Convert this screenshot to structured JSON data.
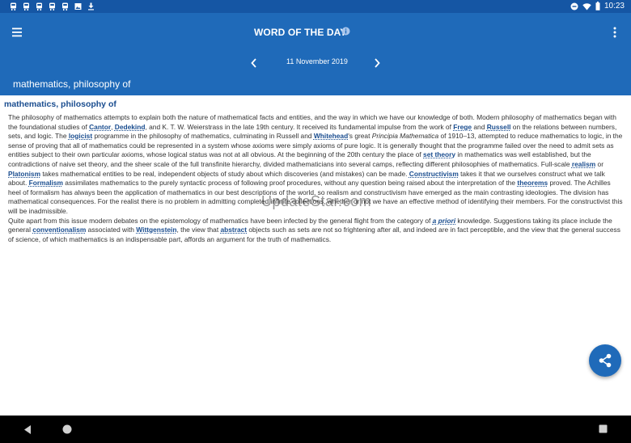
{
  "status_bar": {
    "time": "10:23",
    "notification_icons": [
      "train-icon",
      "train-icon",
      "train-icon",
      "train-icon",
      "train-icon",
      "image-icon",
      "download-icon"
    ],
    "system_icons": [
      "minus-circle-icon",
      "wifi-icon",
      "battery-icon"
    ]
  },
  "app_bar": {
    "title": "WORD OF THE DAY",
    "date": "11 November 2019",
    "current_word": "mathematics, philosophy of"
  },
  "entry": {
    "title": "mathematics, philosophy of",
    "s1": "The philosophy of mathematics attempts to explain both the nature of mathematical facts and entities, and the way in which we have our knowledge of both. Modern philosophy of mathematics began with the foundational studies of ",
    "l_cantor": "Cantor",
    "s2": ", ",
    "l_dedekind": "Dedekind",
    "s3": ", and K. T. W. Weierstrass in the late 19th century. It received its fundamental impulse from the work of ",
    "l_frege": "Frege",
    "s4": " and ",
    "l_russell": "Russell",
    "s5": " on the relations between numbers, sets, and logic. The ",
    "l_logicist": "logicist",
    "s6": " programme in the philosophy of mathematics, culminating in Russell and ",
    "l_whitehead": "Whitehead",
    "s7": "'s great ",
    "i_principia": "Principia Mathematica",
    "s8": " of 1910–13, attempted to reduce mathematics to logic, in the sense of proving that all of mathematics could be represented in a system whose axioms were simply axioms of pure logic. It is generally thought that the programme failed over the need to admit sets as entities subject to their own particular axioms, whose logical status was not at all obvious. At the beginning of the 20th century the place of ",
    "l_settheory": "set theory",
    "s9": " in mathematics was well established, but the contradictions of naive set theory, and the sheer scale of the full transfinite hierarchy, divided mathematicians into several camps, reflecting different philosophies of mathematics. Full-scale ",
    "l_realism": "realism",
    "s10": " or ",
    "l_platonism": "Platonism",
    "s11": " takes mathematical entities to be real, independent objects of study about which discoveries (and mistakes) can be made. ",
    "l_constructivism": "Constructivism",
    "s12": " takes it that we ourselves construct what we talk about. ",
    "l_formalism": "Formalism",
    "s13": " assimilates mathematics to the purely syntactic process of following proof procedures, without any question being raised about the interpretation of the ",
    "l_theorems": "theorems",
    "s14": " proved. The Achilles heel of formalism has always been the application of mathematics in our best descriptions of the world, so realism and constructivism have emerged as the main contrasting ideologies. The division has mathematical consequences. For the realist there is no problem in admitting completed infinite collections, whether or not we have an effective method of identifying their members. For the constructivist this will be inadmissible.",
    "p2_s1": "Quite apart from this issue modern debates on the epistemology of mathematics have been infected by the general flight from the category of ",
    "l_apriori": "a priori",
    "p2_s2": " knowledge. Suggestions taking its place include the general ",
    "l_conventionalism": "conventionalism",
    "p2_s3": " associated with ",
    "l_wittgenstein": "Wittgenstein",
    "p2_s4": ", the view that ",
    "l_abstract": "abstract",
    "p2_s5": " objects such as sets are not so frightening after all, and indeed are in fact perceptible, and the view that the general success of science, of which mathematics is an indispensable part, affords an argument for the truth of mathematics."
  },
  "watermark": "UpdateStar.com",
  "colors": {
    "status_bar": "#1556a4",
    "app_bar": "#1f6ab9",
    "link": "#1a4d8f",
    "fab": "#1f6ab9",
    "nav_bar": "#000000"
  }
}
